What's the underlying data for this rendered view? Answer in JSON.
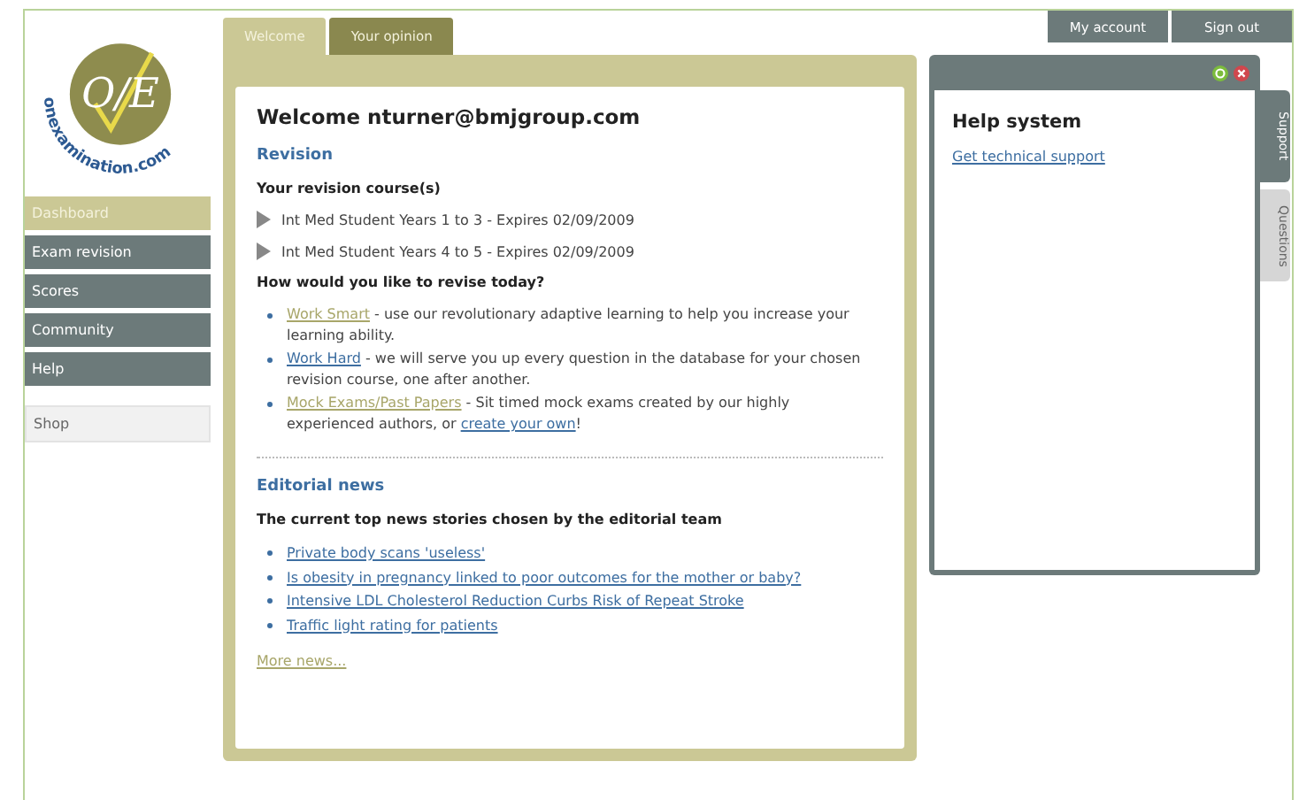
{
  "logo": {
    "mark": "O/E",
    "wordmark": "onexamination.com"
  },
  "nav": [
    {
      "label": "Dashboard",
      "kind": "main",
      "selected": true
    },
    {
      "label": "Exam revision",
      "kind": "main",
      "selected": false
    },
    {
      "label": "Scores",
      "kind": "main",
      "selected": false
    },
    {
      "label": "Community",
      "kind": "main",
      "selected": false
    },
    {
      "label": "Help",
      "kind": "main",
      "selected": false
    },
    {
      "label": "Shop",
      "kind": "shop",
      "selected": false
    }
  ],
  "tabs": [
    {
      "label": "Welcome",
      "selected": true
    },
    {
      "label": "Your opinion",
      "selected": false
    }
  ],
  "account_buttons": [
    "My account",
    "Sign out"
  ],
  "welcome": {
    "heading": "Welcome nturner@bmjgroup.com",
    "section": "Revision",
    "courses_heading": "Your revision course(s)",
    "courses": [
      "Int Med Student Years 1 to 3 - Expires 02/09/2009",
      "Int Med Student Years 4 to 5 - Expires 02/09/2009"
    ],
    "revise_heading": "How would you like to revise today?",
    "revise_options": [
      [
        {
          "kind": "link",
          "text": "Work Smart",
          "visited": true
        },
        {
          "kind": "text",
          "text": " - use our revolutionary adaptive learning to help you increase your learning ability."
        }
      ],
      [
        {
          "kind": "link",
          "text": "Work Hard",
          "visited": false
        },
        {
          "kind": "text",
          "text": " - we will serve you up every question in the database for your chosen revision course, one after another."
        }
      ],
      [
        {
          "kind": "link",
          "text": "Mock Exams/Past Papers",
          "visited": true
        },
        {
          "kind": "text",
          "text": " - Sit timed mock exams created by our highly experienced authors, or "
        },
        {
          "kind": "link",
          "text": "create your own",
          "visited": false
        },
        {
          "kind": "text",
          "text": "!"
        }
      ]
    ]
  },
  "news": {
    "section": "Editorial news",
    "heading": "The current top news stories chosen by the editorial team",
    "stories": [
      "Private body scans 'useless'",
      "Is obesity in pregnancy linked to poor outcomes for the mother or baby?",
      "Intensive LDL Cholesterol Reduction Curbs Risk of Repeat Stroke",
      "Traffic light rating for patients"
    ],
    "more": "More news..."
  },
  "help": {
    "title": "Help system",
    "link": "Get technical support",
    "side_tabs": [
      {
        "label": "Support",
        "selected": true
      },
      {
        "label": "Questions",
        "selected": false
      }
    ]
  }
}
